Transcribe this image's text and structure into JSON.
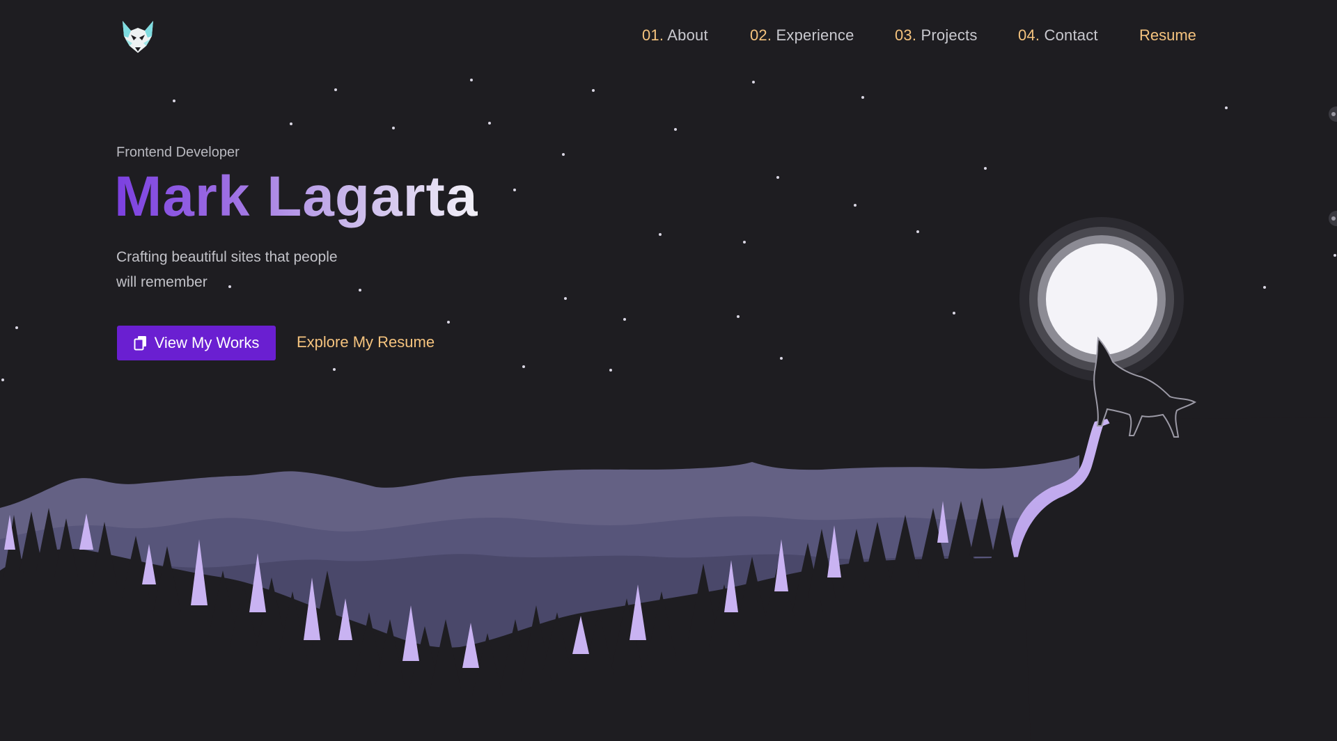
{
  "header": {
    "logo_icon": "wolf-head-icon",
    "nav": [
      {
        "num": "01.",
        "label": "About"
      },
      {
        "num": "02.",
        "label": "Experience"
      },
      {
        "num": "03.",
        "label": "Projects"
      },
      {
        "num": "04.",
        "label": "Contact"
      }
    ],
    "resume_label": "Resume"
  },
  "hero": {
    "role": "Frontend Developer",
    "name": "Mark Lagarta",
    "tagline_line1": "Crafting beautiful sites that people",
    "tagline_line2": "will remember",
    "primary_button": {
      "label": "View My Works",
      "icon": "copy-icon"
    },
    "secondary_link": "Explore My Resume"
  },
  "colors": {
    "background": "#1e1d21",
    "accent_orange": "#f5c37e",
    "accent_purple": "#6a1fd1",
    "mountain": "#646184",
    "tree_highlight": "#c9b3f2",
    "moon": "#f4f3f8"
  },
  "scene_icons": [
    "moon-icon",
    "howling-wolf-icon",
    "pine-tree-icon"
  ]
}
